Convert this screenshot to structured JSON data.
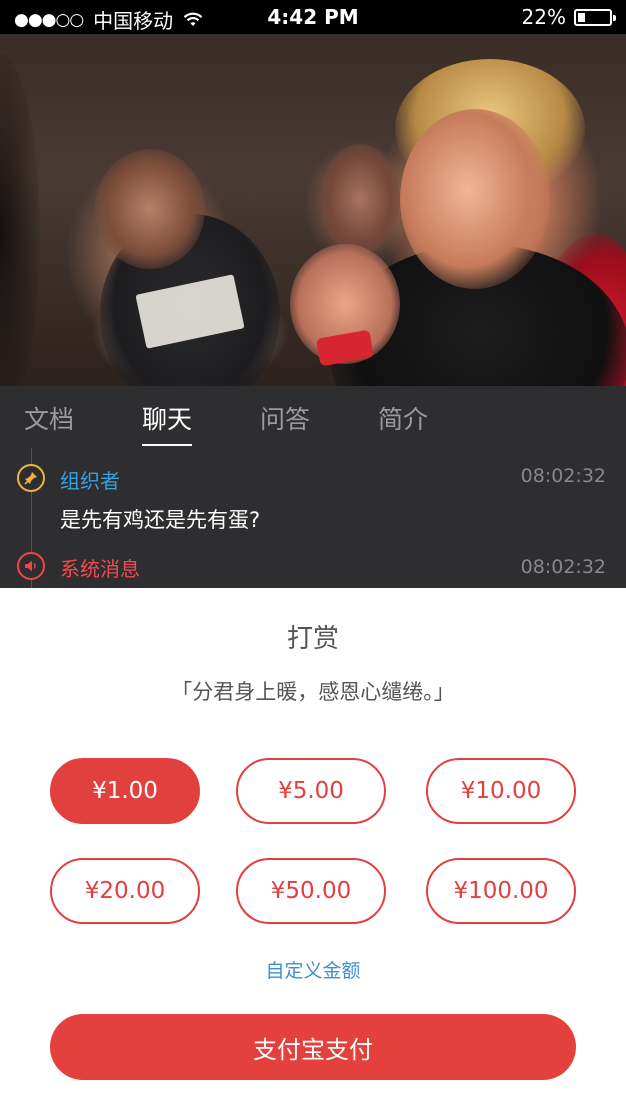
{
  "status_bar": {
    "signal": "●●●○○",
    "carrier": "中国移动",
    "time": "4:42 PM",
    "battery_percent": "22%",
    "battery_level": 0.22
  },
  "tabs": [
    {
      "label": "文档",
      "active": false
    },
    {
      "label": "聊天",
      "active": true
    },
    {
      "label": "问答",
      "active": false
    },
    {
      "label": "简介",
      "active": false
    }
  ],
  "chat": {
    "messages": [
      {
        "sender": "组织者",
        "time": "08:02:32",
        "text": "是先有鸡还是先有蛋?",
        "icon": "pin-icon"
      },
      {
        "sender": "系统消息",
        "time": "08:02:32",
        "text": "",
        "icon": "speaker-icon"
      }
    ]
  },
  "reward": {
    "title": "打赏",
    "quote": "「分君身上暖，感恩心缱绻。」",
    "amounts": [
      "¥1.00",
      "¥5.00",
      "¥10.00",
      "¥20.00",
      "¥50.00",
      "¥100.00"
    ],
    "selected_index": 0,
    "custom_amount_label": "自定义金额",
    "pay_button_label": "支付宝支付"
  },
  "colors": {
    "accent_red": "#e2403f",
    "link_blue": "#3f8fd0",
    "organizer_blue": "#3aa0e0",
    "dark_panel": "#2e2e30"
  }
}
